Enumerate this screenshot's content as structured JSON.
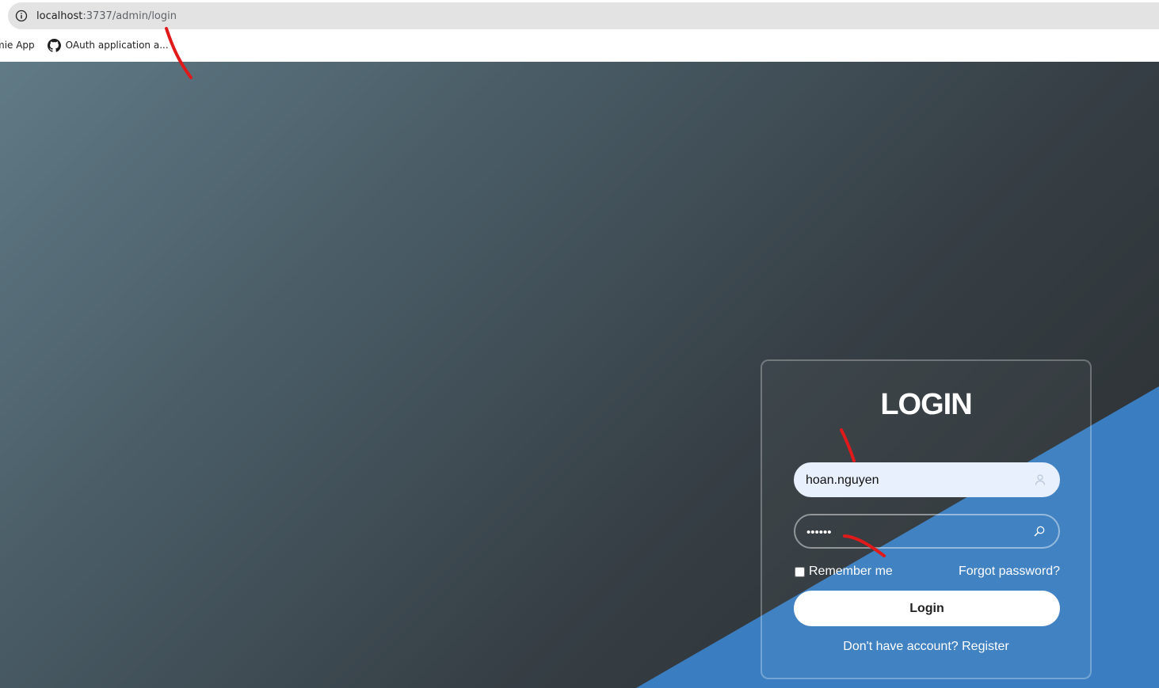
{
  "browser": {
    "url_host": "localhost",
    "url_path": ":3737/admin/login",
    "bookmarks": [
      {
        "label": "mie App"
      },
      {
        "label": "OAuth application a..."
      }
    ]
  },
  "login": {
    "title": "LOGIN",
    "username_value": "hoan.nguyen",
    "password_value": "••••••",
    "remember_label": "Remember me",
    "forgot_label": "Forgot password?",
    "submit_label": "Login",
    "register_prompt": "Don't have account?",
    "register_link": "Register"
  },
  "colors": {
    "accent_blue": "#3a7ec1",
    "annotation_red": "#e01a1a"
  },
  "icons": {
    "address_info": "info-icon",
    "bookmark_2": "github-icon",
    "username_field": "user-icon",
    "password_field": "search-icon"
  }
}
